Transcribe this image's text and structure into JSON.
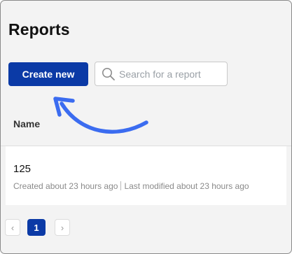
{
  "page": {
    "title": "Reports"
  },
  "toolbar": {
    "create_label": "Create new",
    "search": {
      "placeholder": "Search for a report",
      "value": ""
    }
  },
  "table": {
    "columns": [
      "Name"
    ],
    "rows": [
      {
        "name": "125",
        "created": "Created about 23 hours ago",
        "modified": "Last modified about 23 hours ago"
      }
    ]
  },
  "pagination": {
    "prev_symbol": "‹",
    "current_page": "1",
    "next_symbol": "›"
  },
  "colors": {
    "accent": "#0b3aa6",
    "annotation_arrow": "#3b6cf0",
    "background": "#f3f3f3"
  },
  "icons": {
    "search": "search-icon",
    "annotation": "curved-arrow-icon"
  }
}
